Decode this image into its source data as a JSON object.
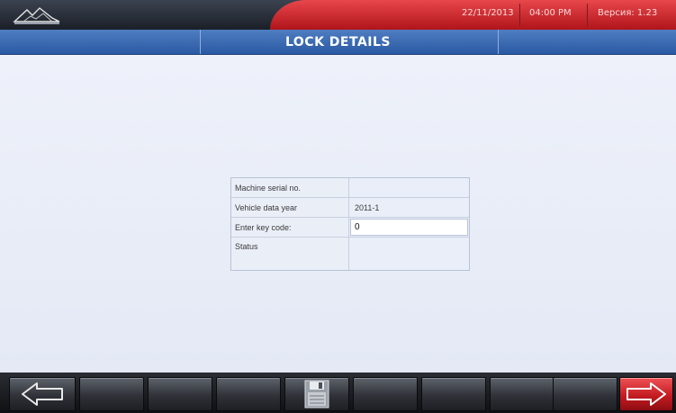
{
  "header": {
    "date": "22/11/2013",
    "time": "04:00 PM",
    "version": "Версия: 1.23"
  },
  "page": {
    "title": "LOCK DETAILS"
  },
  "details": {
    "rows": [
      {
        "label": "Machine serial no.",
        "value": ""
      },
      {
        "label": "Vehicle data year",
        "value": "2011-1"
      },
      {
        "label": "Enter key code:",
        "value": "0"
      },
      {
        "label": "Status",
        "value": ""
      }
    ]
  },
  "toolbar": {
    "icons": [
      "arrow-left-icon",
      "save-disk-icon",
      "arrow-right-icon"
    ]
  },
  "colors": {
    "accent_red": "#c41c22",
    "title_blue": "#3a68b0"
  }
}
